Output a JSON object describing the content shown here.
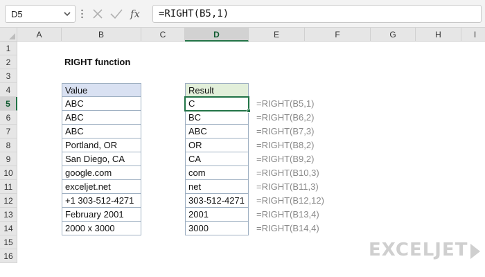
{
  "formula_bar": {
    "name_box": "D5",
    "formula": "=RIGHT(B5,1)"
  },
  "columns": [
    "A",
    "B",
    "C",
    "D",
    "E",
    "F",
    "G",
    "H",
    "I"
  ],
  "rows": [
    "1",
    "2",
    "3",
    "4",
    "5",
    "6",
    "7",
    "8",
    "9",
    "10",
    "11",
    "12",
    "13",
    "14",
    "15",
    "16"
  ],
  "selected_column": "D",
  "selected_row": "5",
  "sheet": {
    "title": "RIGHT function",
    "value_header": "Value",
    "result_header": "Result",
    "values": [
      "ABC",
      "ABC",
      "ABC",
      "Portland, OR",
      "San Diego, CA",
      "google.com",
      "exceljet.net",
      "+1 303-512-4271",
      "February 2001",
      "2000 x 3000"
    ],
    "results": [
      "C",
      "BC",
      "ABC",
      "OR",
      "CA",
      "com",
      "net",
      "303-512-4271",
      "2001",
      "3000"
    ],
    "formulas": [
      "=RIGHT(B5,1)",
      "=RIGHT(B6,2)",
      "=RIGHT(B7,3)",
      "=RIGHT(B8,2)",
      "=RIGHT(B9,2)",
      "=RIGHT(B10,3)",
      "=RIGHT(B11,3)",
      "=RIGHT(B12,12)",
      "=RIGHT(B13,4)",
      "=RIGHT(B14,4)"
    ]
  },
  "logo": {
    "text": "EXCELJET"
  },
  "colors": {
    "accent": "#217346",
    "value_header_bg": "#d9e1f2",
    "result_header_bg": "#e2efda",
    "note_text": "#8a8a8a"
  },
  "icons": {
    "namebox_dropdown": "chevron-down-icon",
    "separator": "vertical-dots-icon",
    "cancel": "cancel-x-icon",
    "enter": "checkmark-icon",
    "insert_function": "fx-icon"
  }
}
